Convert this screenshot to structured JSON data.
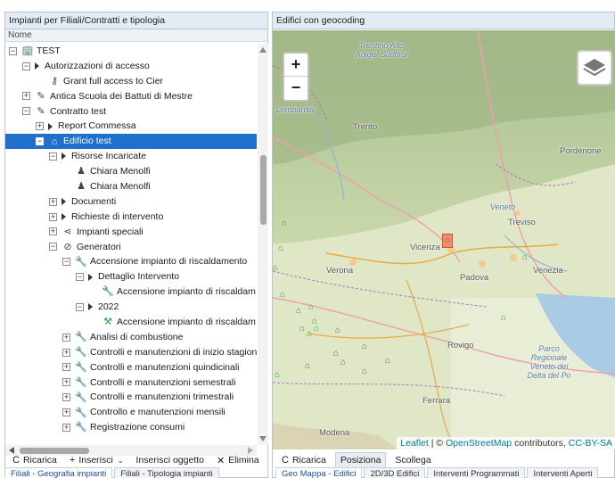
{
  "left_panel": {
    "title": "Impianti per Filiali/Contratti e tipologia",
    "column_header": "Nome",
    "tree": [
      {
        "indent": 0,
        "toggle": "−",
        "icon": "building-icon",
        "glyph": "🏢",
        "icon_color": "grey",
        "label": "TEST"
      },
      {
        "indent": 1,
        "toggle": "−",
        "tri": true,
        "label": "Autorizzazioni di accesso"
      },
      {
        "indent": 2,
        "icon": "access-key-icon",
        "glyph": "⚷",
        "icon_color": "grey",
        "label": "Grant full access to Cier"
      },
      {
        "indent": 1,
        "toggle": "+",
        "icon": "edit-icon",
        "glyph": "✎",
        "icon_color": "grey",
        "label": "Antica Scuola dei Battuti di Mestre"
      },
      {
        "indent": 1,
        "toggle": "−",
        "icon": "edit-icon",
        "glyph": "✎",
        "icon_color": "grey",
        "label": "Contratto test"
      },
      {
        "indent": 2,
        "toggle": "+",
        "tri": true,
        "label": "Report Commessa"
      },
      {
        "indent": 2,
        "toggle": "−",
        "icon": "building-green-icon",
        "glyph": "⌂",
        "icon_color": "green",
        "label": "Edificio test",
        "selected": true
      },
      {
        "indent": 3,
        "toggle": "−",
        "tri": true,
        "label": "Risorse Incaricate"
      },
      {
        "indent": 4,
        "icon": "person-icon",
        "glyph": "♟",
        "icon_color": "grey",
        "label": "Chiara Menolfi"
      },
      {
        "indent": 4,
        "icon": "person-icon",
        "glyph": "♟",
        "icon_color": "grey",
        "label": "Chiara Menolfi"
      },
      {
        "indent": 3,
        "toggle": "+",
        "tri": true,
        "label": "Documenti"
      },
      {
        "indent": 3,
        "toggle": "+",
        "tri": true,
        "label": "Richieste di intervento"
      },
      {
        "indent": 3,
        "toggle": "+",
        "icon": "share-icon",
        "glyph": "⋖",
        "icon_color": "grey",
        "label": "Impianti speciali"
      },
      {
        "indent": 3,
        "toggle": "−",
        "icon": "generator-icon",
        "glyph": "⊘",
        "icon_color": "grey",
        "label": "Generatori"
      },
      {
        "indent": 4,
        "toggle": "−",
        "icon": "wrench-green-icon",
        "glyph": "🔧",
        "icon_color": "green",
        "label": "Accensione impianto di riscaldamento"
      },
      {
        "indent": 5,
        "toggle": "−",
        "tri": true,
        "label": "Dettaglio Intervento"
      },
      {
        "indent": 6,
        "icon": "wrench-icon",
        "glyph": "🔧",
        "icon_color": "grey",
        "label": "Accensione impianto di riscaldam"
      },
      {
        "indent": 5,
        "toggle": "−",
        "tri": true,
        "label": "2022"
      },
      {
        "indent": 6,
        "icon": "worker-icon",
        "glyph": "⚒",
        "icon_color": "green",
        "label": "Accensione impianto di riscaldam"
      },
      {
        "indent": 4,
        "toggle": "+",
        "icon": "wrench-orange-icon",
        "glyph": "🔧",
        "icon_color": "orange",
        "label": "Analisi di combustione"
      },
      {
        "indent": 4,
        "toggle": "+",
        "icon": "wrench-orange-icon",
        "glyph": "🔧",
        "icon_color": "orange",
        "label": "Controlli e manutenzioni di inizio stagione"
      },
      {
        "indent": 4,
        "toggle": "+",
        "icon": "wrench-orange-icon",
        "glyph": "🔧",
        "icon_color": "orange",
        "label": "Controlli e manutenzioni quindicinali"
      },
      {
        "indent": 4,
        "toggle": "+",
        "icon": "wrench-orange-icon",
        "glyph": "🔧",
        "icon_color": "orange",
        "label": "Controlli e manutenzioni semestrali"
      },
      {
        "indent": 4,
        "toggle": "+",
        "icon": "wrench-orange-icon",
        "glyph": "🔧",
        "icon_color": "orange",
        "label": "Controlli e manutenzioni trimestrali"
      },
      {
        "indent": 4,
        "toggle": "+",
        "icon": "wrench-orange-icon",
        "glyph": "🔧",
        "icon_color": "orange",
        "label": "Controllo e manutenzioni mensili"
      },
      {
        "indent": 4,
        "toggle": "+",
        "icon": "wrench-orange-icon",
        "glyph": "🔧",
        "icon_color": "orange",
        "label": "Registrazione consumi"
      }
    ],
    "toolbar": {
      "reload": "Ricarica",
      "insert": "Inserisci",
      "insert_object": "Inserisci oggetto",
      "delete": "Elimina"
    },
    "tabs": [
      "Filiali - Geografia impianti",
      "Filiali - Tipologia impianti"
    ]
  },
  "right_panel": {
    "title": "Edifici con geocoding",
    "zoom_in": "+",
    "zoom_out": "−",
    "attribution": {
      "leaflet": "Leaflet",
      "sep": " | © ",
      "osm": "OpenStreetMap",
      "contributors": " contributors, ",
      "license": "CC-BY-SA"
    },
    "places": [
      "Trentino Alto Adige/ Südtirol",
      "Lombardia",
      "Trento",
      "Pordenone",
      "Veneto",
      "Treviso",
      "Vicenza",
      "Venezia",
      "Verona",
      "Padova",
      "Rovigo",
      "Parco Regionale Veneto del Delta del Po",
      "Ferrara",
      "Modena"
    ],
    "toolbar": {
      "reload": "Ricarica",
      "position": "Posiziona",
      "detach": "Scollega"
    },
    "tabs": [
      "Geo Mappa - Edifici",
      "2D/3D Edifici",
      "Interventi Programmati",
      "Interventi Aperti"
    ]
  },
  "colors": {
    "selection": "#1f6fcc",
    "header_bg": "#e3ebf5",
    "marker_green": "#2f9e3c",
    "marker_selected": "#f08c6c"
  }
}
